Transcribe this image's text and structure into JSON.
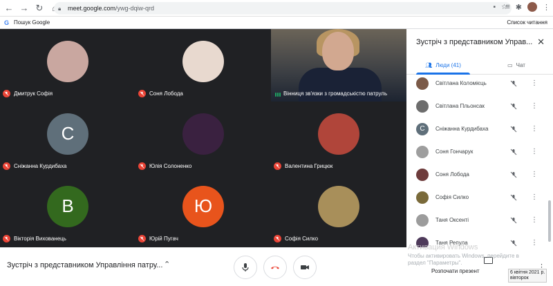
{
  "browser": {
    "url_host": "meet.google.com",
    "url_path": "/ywg-dqiw-qrd",
    "bookmark_search": "Пошук Google",
    "reading_list": "Список читання"
  },
  "stage": {
    "tiles": [
      {
        "name": "Дмитрук Софія",
        "initial": "",
        "color": "#c9a7a0"
      },
      {
        "name": "Соня Лобода",
        "initial": "",
        "color": "#e8d9cf"
      },
      {
        "name": "Сніжанна Курдибаха",
        "initial": "С",
        "color": "#5f6f7a"
      },
      {
        "name": "Юлія Солоненко",
        "initial": "",
        "color": "#3a2140"
      },
      {
        "name": "Валентина Грицюк",
        "initial": "",
        "color": "#b0453a"
      },
      {
        "name": "Вікторія Вихованець",
        "initial": "В",
        "color": "#33691e"
      },
      {
        "name": "Юрій Пугач",
        "initial": "Ю",
        "color": "#e8541c"
      },
      {
        "name": "Софія Силко",
        "initial": "",
        "color": "#a88f5a"
      }
    ],
    "video": {
      "name": "Вінниця зв'язки з громадськістю патруль"
    }
  },
  "panel": {
    "title": "Зустріч з представником Управ...",
    "tab_people": "Люди (41)",
    "tab_chat": "Чат",
    "people": [
      {
        "name": "Світлана Коломієць",
        "initial": "",
        "color": "#7b5a48"
      },
      {
        "name": "Світлана Пльонсак",
        "initial": "",
        "color": "#6d6d6d"
      },
      {
        "name": "Сніжанна Курдибаха",
        "initial": "С",
        "color": "#5f6f7a"
      },
      {
        "name": "Соня Гончарук",
        "initial": "",
        "color": "#9e9e9e"
      },
      {
        "name": "Соня Лобода",
        "initial": "",
        "color": "#6e3c3c"
      },
      {
        "name": "Софія Силко",
        "initial": "",
        "color": "#7a6a3a"
      },
      {
        "name": "Таня Оксенті",
        "initial": "",
        "color": "#9c9c9c"
      },
      {
        "name": "Таня Репула",
        "initial": "",
        "color": "#4e3a5a"
      }
    ]
  },
  "bottom": {
    "meeting_title": "Зустріч з представником Управління патру...",
    "present": "Розпочати презент",
    "activate_title": "Активация Windows",
    "activate_text": "Чтобы активировать Windows, перейдите в раздел \"Параметры\".",
    "clock_date": "6 квітня 2021 р.",
    "clock_day": "вівторок"
  },
  "colors": {
    "accent": "#1a73e8",
    "mute_red": "#ea4335",
    "stage_bg": "#202124"
  }
}
